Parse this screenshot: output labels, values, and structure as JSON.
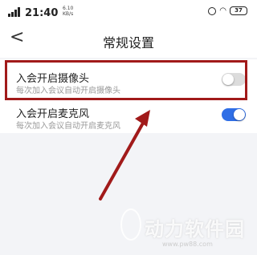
{
  "status_bar": {
    "time": "21:40",
    "network_speed": "6.10",
    "network_unit": "KB/s",
    "battery": "37"
  },
  "nav": {
    "back_glyph": "<",
    "title": "常规设置"
  },
  "settings": [
    {
      "label": "入会开启摄像头",
      "description": "每次加入会议自动开启摄像头",
      "enabled": false
    },
    {
      "label": "入会开启麦克风",
      "description": "每次加入会议自动开启麦克风",
      "enabled": true
    }
  ],
  "colors": {
    "toggle_on": "#2f6ee6",
    "toggle_off": "#dcdcdc",
    "highlight": "#a11a1a"
  },
  "watermark": {
    "text": "动力软件园",
    "url": "www.pw88.com"
  }
}
